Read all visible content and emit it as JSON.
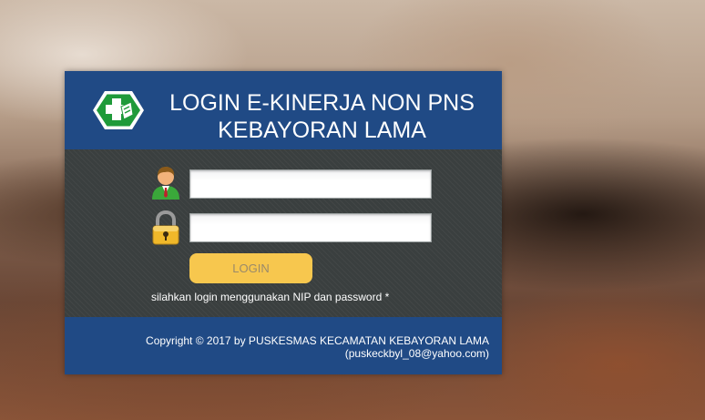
{
  "header": {
    "title_line1": "LOGIN E-KINERJA NON PNS",
    "title_line2": "KEBAYORAN LAMA",
    "logo_icon": "puskesmas-logo-icon"
  },
  "form": {
    "username_icon": "user-icon",
    "username_value": "",
    "password_icon": "lock-icon",
    "password_value": "",
    "login_label": "LOGIN",
    "hint": "silahkan login menggunakan NIP dan password *"
  },
  "footer": {
    "copyright": "Copyright © 2017 by PUSKESMAS KECAMATAN KEBAYORAN LAMA",
    "email": "(puskeckbyl_08@yahoo.com)"
  },
  "colors": {
    "header_bg": "#204a85",
    "body_bg": "#3a3f3f",
    "button_bg": "#f7c74e",
    "logo_green": "#1f9a3a"
  }
}
